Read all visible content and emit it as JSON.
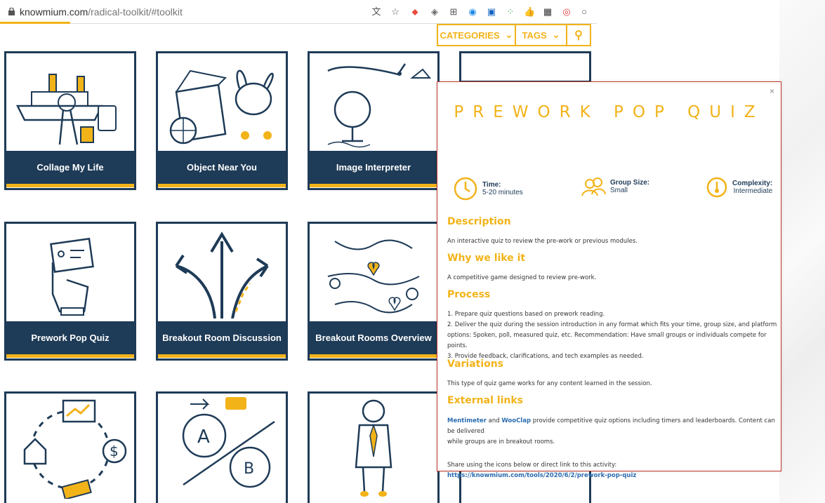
{
  "browser": {
    "url_host": "knowmium.com",
    "url_path": "/radical-toolkit/#toolkit"
  },
  "filter": {
    "categories": "CATEGORIES",
    "tags": "TAGS"
  },
  "cards": [
    {
      "label": "Collage My Life"
    },
    {
      "label": "Object Near You"
    },
    {
      "label": "Image Interpreter"
    },
    {
      "label": "Prework Pop Quiz"
    },
    {
      "label": "Breakout Room Discussion"
    },
    {
      "label": "Breakout Rooms Overview"
    }
  ],
  "modal": {
    "close": "×",
    "title": "PREWORK POP QUIZ",
    "time_label": "Time:",
    "time_value": "5-20 minutes",
    "group_label": "Group Size:",
    "group_value": "Small",
    "complexity_label": "Complexity:",
    "complexity_value": "Intermediate",
    "description_h": "Description",
    "description": "An interactive quiz to review the pre-work or previous modules.",
    "why_h": "Why we like it",
    "why": "A competitive game designed to review pre-work.",
    "process_h": "Process",
    "process_1": "1. Prepare quiz questions based on prework reading.",
    "process_2a": "2. Deliver the quiz during the session introduction in any format which fits your time, group size, and platform",
    "process_2b": "options: Spoken, poll, measured quiz, etc. Recommendation: Have small groups or individuals compete for points.",
    "process_3": "3. Provide feedback, clarifications, and tech examples as needed.",
    "variations_h": "Variations",
    "variations": "This type of quiz game works for any content learned in the session.",
    "links_h": "External links",
    "link_1": "Mentimeter",
    "and": " and ",
    "link_2": "WooClap",
    "links_text_a": " provide competitive quiz options including timers and leaderboards. Content can be delivered",
    "links_text_b": "while groups are in breakout rooms.",
    "share_text": "Share using the icons below or direct link to this activity: ",
    "share_link": "https://knowmium.com/tools/2020/6/2/prework-pop-quiz"
  }
}
